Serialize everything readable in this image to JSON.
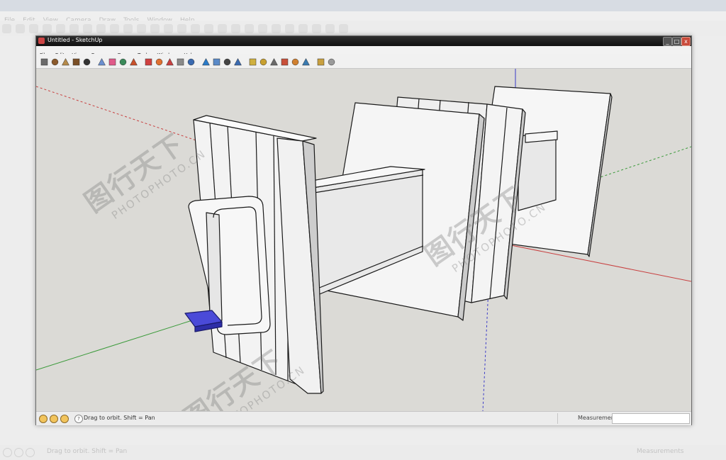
{
  "background_app": {
    "title": "",
    "status_hint": "Drag to orbit.  Shift = Pan",
    "measurements_label": "Measurements"
  },
  "window": {
    "title": "Untitled - SketchUp",
    "controls": {
      "minimize": "_",
      "maximize": "□",
      "close": "x"
    }
  },
  "menu": {
    "items": [
      "File",
      "Edit",
      "View",
      "Camera",
      "Draw",
      "Tools",
      "Window",
      "Help"
    ]
  },
  "toolbar": {
    "tools": [
      "select-tool-icon",
      "line-tool-icon",
      "rectangle-tool-icon",
      "circle-tool-icon",
      "arc-tool-icon",
      "make-component-icon",
      "eraser-icon",
      "paint-bucket-icon",
      "push-pull-icon",
      "move-icon",
      "rotate-icon",
      "follow-me-icon",
      "scale-icon",
      "offset-icon",
      "orbit-icon",
      "pan-icon",
      "zoom-icon",
      "zoom-extents-icon",
      "tape-measure-icon",
      "protractor-icon",
      "text-icon",
      "axes-icon",
      "dimensions-icon",
      "section-plane-icon",
      "3d-warehouse-icon",
      "components-icon"
    ]
  },
  "status": {
    "hint": "Drag to orbit.  Shift = Pan",
    "measurements_label": "Measurements",
    "measurements_value": ""
  },
  "watermark": {
    "cn": "图行天下",
    "en": "PHOTOPHOTO.CN"
  },
  "colors": {
    "viewport_bg": "#dbdad6",
    "axis_red": "#c84040",
    "axis_green": "#3a9a3a",
    "axis_blue": "#3a3ac8",
    "face": "#f4f4f4",
    "edge": "#1a1a1a",
    "selected": "#4a4ad8"
  }
}
